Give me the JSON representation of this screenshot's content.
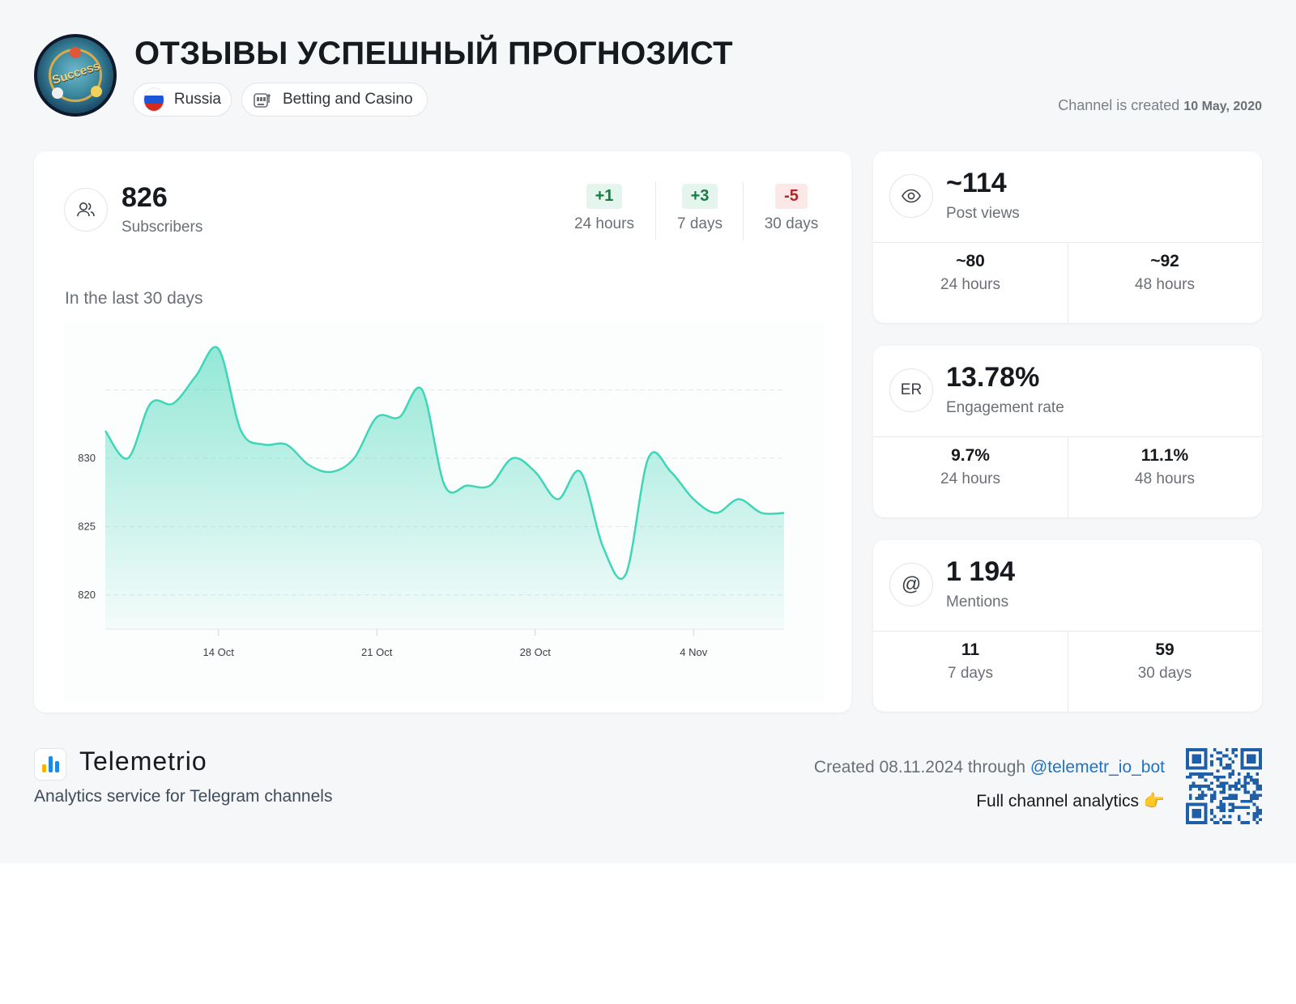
{
  "channel": {
    "title": "ОТЗЫВЫ УСПЕШНЫЙ ПРОГНОЗИСТ",
    "country": "Russia",
    "category": "Betting and Casino",
    "created_label": "Channel is created",
    "created_date": "10 May, 2020",
    "avatar_text": "Success"
  },
  "subscribers": {
    "value": "826",
    "label": "Subscribers",
    "icon": "users-icon",
    "deltas": [
      {
        "value": "+1",
        "label": "24 hours",
        "tone": "positive"
      },
      {
        "value": "+3",
        "label": "7 days",
        "tone": "positive"
      },
      {
        "value": "-5",
        "label": "30 days",
        "tone": "negative"
      }
    ]
  },
  "chart_title": "In the last 30 days",
  "chart_data": {
    "type": "area",
    "x": [
      "9 Oct",
      "10 Oct",
      "11 Oct",
      "12 Oct",
      "13 Oct",
      "14 Oct",
      "15 Oct",
      "16 Oct",
      "17 Oct",
      "18 Oct",
      "19 Oct",
      "20 Oct",
      "21 Oct",
      "22 Oct",
      "23 Oct",
      "24 Oct",
      "25 Oct",
      "26 Oct",
      "27 Oct",
      "28 Oct",
      "29 Oct",
      "30 Oct",
      "31 Oct",
      "1 Nov",
      "2 Nov",
      "3 Nov",
      "4 Nov",
      "5 Nov",
      "6 Nov",
      "7 Nov",
      "8 Nov"
    ],
    "values": [
      832,
      830,
      834,
      834,
      836,
      838,
      832,
      831,
      831,
      829.5,
      829,
      830,
      833,
      833,
      835,
      828,
      828,
      828,
      830,
      829,
      827,
      829,
      823.5,
      821.5,
      830,
      829,
      827,
      826,
      827,
      826,
      826
    ],
    "xticks": [
      "14 Oct",
      "21 Oct",
      "28 Oct",
      "4 Nov"
    ],
    "xtick_positions": [
      "14 Oct",
      "21 Oct",
      "28 Oct",
      "4 Nov"
    ],
    "yticks": [
      820,
      825,
      830
    ],
    "ylim": [
      817.5,
      840
    ],
    "grid": true,
    "color": "#3fd6b8"
  },
  "post_views": {
    "value": "~114",
    "label": "Post views",
    "icon": "eye-icon",
    "subs": [
      {
        "value": "~80",
        "label": "24 hours"
      },
      {
        "value": "~92",
        "label": "48 hours"
      }
    ]
  },
  "engagement": {
    "value": "13.78%",
    "label": "Engagement rate",
    "icon_text": "ER",
    "subs": [
      {
        "value": "9.7%",
        "label": "24 hours"
      },
      {
        "value": "11.1%",
        "label": "48 hours"
      }
    ]
  },
  "mentions": {
    "value": "1 194",
    "label": "Mentions",
    "icon": "at-icon",
    "subs": [
      {
        "value": "11",
        "label": "7 days"
      },
      {
        "value": "59",
        "label": "30 days"
      }
    ]
  },
  "footer": {
    "brand": "Telemetrio",
    "tagline": "Analytics service for Telegram channels",
    "created_text": "Created 08.11.2024 through",
    "bot_link": "@telemetr_io_bot",
    "full_analytics": "Full channel analytics 👉",
    "brand_colors": [
      "#f5b400",
      "#1e88e5",
      "#1e88e5"
    ]
  }
}
